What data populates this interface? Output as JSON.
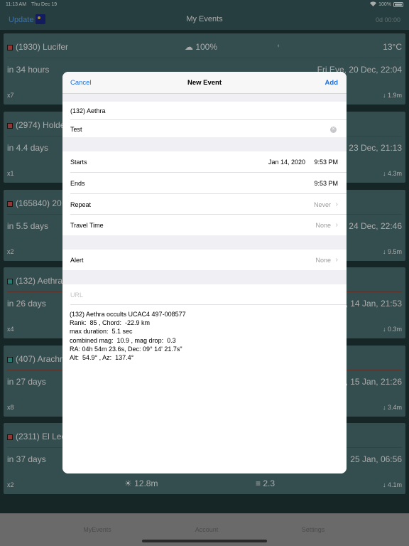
{
  "status": {
    "time": "11:13 AM",
    "date": "Thu Dec 19",
    "battery": "100%"
  },
  "nav": {
    "update_label": "Update",
    "title": "My Events",
    "countdown": "0d 00:00"
  },
  "events": [
    {
      "name": "(1930) Lucifer",
      "sq_color": "#d9534f",
      "weather": "☁ 100%",
      "temp": "13°C",
      "in": "in 34 hours",
      "when": "Fri Eve, 20 Dec, 22:04",
      "count": "x7",
      "drop": "↓ 1.9m"
    },
    {
      "name": "(2974) Holde",
      "sq_color": "#d9534f",
      "weather": "",
      "temp": "",
      "in": "in 4.4 days",
      "when": "23 Dec, 21:13",
      "count": "x1",
      "drop": "↓ 4.3m"
    },
    {
      "name": "(165840) 20",
      "sq_color": "#d9534f",
      "weather": "",
      "temp": "",
      "in": "in 5.5 days",
      "when": "24 Dec, 22:46",
      "count": "x2",
      "drop": "↓ 9.5m"
    },
    {
      "name": "(132) Aethra",
      "sq_color": "#3bb8a8",
      "weather": "",
      "temp": "",
      "in": "in 26 days",
      "when": ", 14 Jan, 21:53",
      "count": "x4",
      "drop": "↓ 0.3m"
    },
    {
      "name": "(407) Arachr",
      "sq_color": "#3bb8a8",
      "weather": "",
      "temp": "",
      "in": "in 27 days",
      "when": ", 15 Jan, 21:26",
      "count": "x8",
      "drop": "↓ 3.4m"
    },
    {
      "name": "(2311) El Lec",
      "sq_color": "#d9534f",
      "weather": "",
      "temp": "",
      "in": "in 37 days",
      "when": "25 Jan, 06:56",
      "count": "x2",
      "drop": "↓ 4.1m",
      "mag": "☀ 12.8m",
      "mag2": "≡ 2.3"
    }
  ],
  "modal": {
    "cancel": "Cancel",
    "title": "New Event",
    "add": "Add",
    "event_title": "(132) Aethra",
    "location": "Test",
    "starts_label": "Starts",
    "starts_date": "Jan 14, 2020",
    "starts_time": "9:53 PM",
    "ends_label": "Ends",
    "ends_time": "9:53 PM",
    "repeat_label": "Repeat",
    "repeat_value": "Never",
    "travel_label": "Travel Time",
    "travel_value": "None",
    "alert_label": "Alert",
    "alert_value": "None",
    "url_placeholder": "URL",
    "notes": [
      "(132) Aethra occults UCAC4 497-008577",
      "Rank:  85 , Chord:  -22.9 km",
      "max duration:  5.1 sec",
      "combined mag:  10.9 , mag drop:  0.3",
      "RA: 04h 54m 23.6s, Dec: 09° 14' 21.7s\"",
      "Alt:  54.9° , Az:  137.4°"
    ]
  },
  "tabs": [
    "MyEvents",
    "Account",
    "Settings"
  ]
}
